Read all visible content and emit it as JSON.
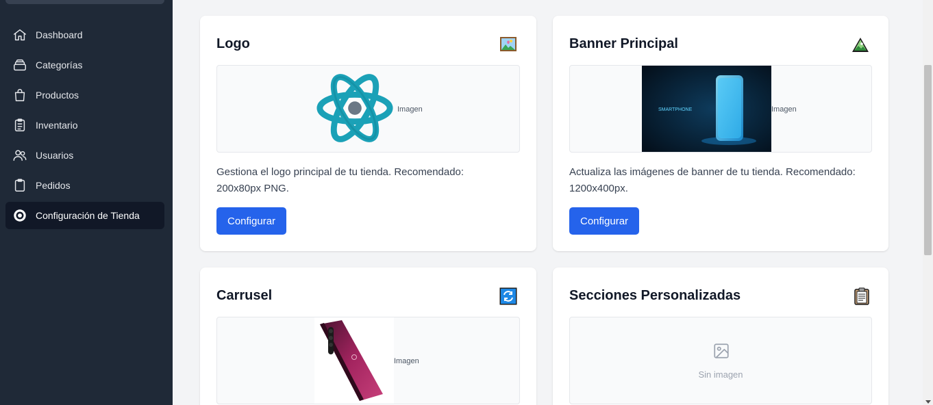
{
  "sidebar": {
    "items": [
      {
        "label": "Dashboard",
        "icon": "home-icon"
      },
      {
        "label": "Categorías",
        "icon": "layers-icon"
      },
      {
        "label": "Productos",
        "icon": "shopping-bag-icon"
      },
      {
        "label": "Inventario",
        "icon": "clipboard-list-icon"
      },
      {
        "label": "Usuarios",
        "icon": "users-icon"
      },
      {
        "label": "Pedidos",
        "icon": "clipboard-icon"
      },
      {
        "label": "Configuración de Tienda",
        "icon": "store-settings-icon",
        "active": true
      }
    ]
  },
  "cards": {
    "logo": {
      "title": "Logo",
      "emoji": "framed-picture-icon",
      "image_alt": "Imagen",
      "description": "Gestiona el logo principal de tu tienda. Recomendado: 200x80px PNG.",
      "button": "Configurar"
    },
    "banner": {
      "title": "Banner Principal",
      "emoji": "mountain-picture-icon",
      "image_alt": "Imagen",
      "description": "Actualiza las imágenes de banner de tu tienda. Recomendado: 1200x400px.",
      "button": "Configurar",
      "banner_text": "SMARTPHONE"
    },
    "carousel": {
      "title": "Carrusel",
      "emoji": "refresh-arrows-icon",
      "image_alt": "Imagen"
    },
    "sections": {
      "title": "Secciones Personalizadas",
      "emoji": "clipboard-emoji-icon",
      "empty_text": "Sin imagen"
    }
  },
  "colors": {
    "sidebar_bg": "#1f2937",
    "active_bg": "#111827",
    "primary": "#2563eb",
    "page_bg": "#f3f4f6"
  }
}
